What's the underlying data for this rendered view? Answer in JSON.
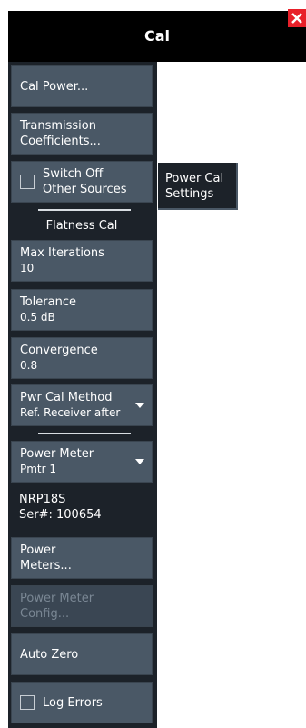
{
  "window": {
    "title": "Cal"
  },
  "buttons": {
    "cal_power": "Cal Power...",
    "transmission": [
      "Transmission",
      "Coefficients..."
    ],
    "switch_off": [
      "Switch Off",
      "Other Sources"
    ],
    "max_iterations": {
      "label": "Max Iterations",
      "value": "10"
    },
    "tolerance": {
      "label": "Tolerance",
      "value": "0.5 dB"
    },
    "convergence": {
      "label": "Convergence",
      "value": "0.8"
    },
    "pwr_cal_method": {
      "label": "Pwr Cal Method",
      "value": "Ref. Receiver after"
    },
    "power_meter": {
      "label": "Power Meter",
      "value": "Pmtr 1"
    },
    "power_meters": [
      "Power",
      "Meters..."
    ],
    "power_meter_config": [
      "Power Meter",
      "Config..."
    ],
    "auto_zero": "Auto Zero",
    "log_errors": "Log Errors"
  },
  "section": {
    "flatness_cal": "Flatness Cal"
  },
  "meter_info": {
    "model": "NRP18S",
    "serial": "Ser#: 100654"
  },
  "flyout": {
    "line1": "Power Cal",
    "line2": "Settings"
  },
  "states": {
    "switch_off_checked": false,
    "log_errors_checked": false
  },
  "colors": {
    "panel": "#1c2229",
    "button": "#4a5866",
    "title_bar": "#000000",
    "close": "#e8202a",
    "disabled_text": "#7a8794"
  },
  "icons": {
    "close": "close-icon",
    "dropdown": "chevron-down-icon",
    "checkbox": "checkbox-icon"
  }
}
